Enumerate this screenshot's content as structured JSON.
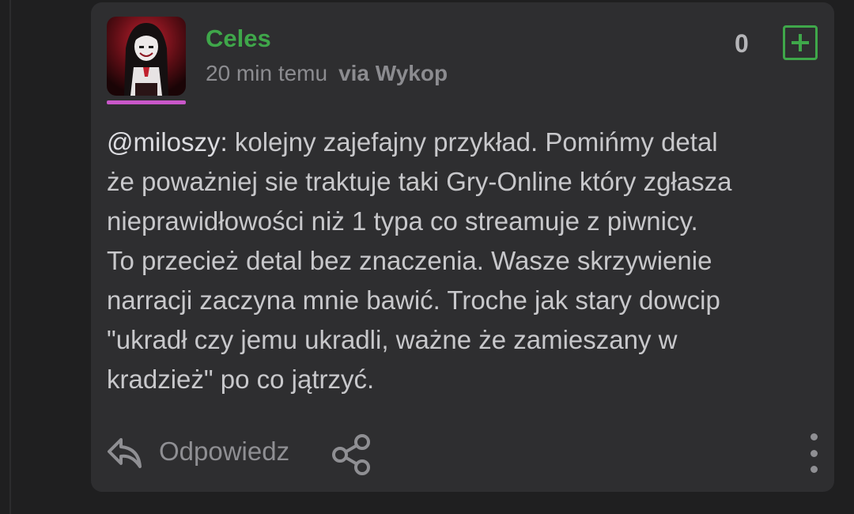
{
  "comment": {
    "username": "Celes",
    "time": "20 min temu",
    "via": "via Wykop",
    "vote_count": "0",
    "mention": "@miloszy:",
    "body": " kolejny zajefajny przykład. Pomińmy detal\nże poważniej sie traktuje taki Gry-Online który zgłasza\nnieprawidłowości niż 1 typa co streamuje z piwnicy.\nTo przecież detal bez znaczenia. Wasze skrzywienie\nnarracji zaczyna mnie bawić. Troche jak stary dowcip\n\"ukradł czy jemu ukradli, ważne że zamieszany w\nkradzież\" po co jątrzyć.",
    "reply_label": "Odpowiedz"
  },
  "icons": {
    "plus": "plus-icon",
    "reply": "reply-icon",
    "share": "share-icon",
    "more": "more-vertical-icon"
  },
  "colors": {
    "username": "#3fa74a",
    "accent_underline": "#c957c9",
    "card_bg": "#2e2e30"
  }
}
